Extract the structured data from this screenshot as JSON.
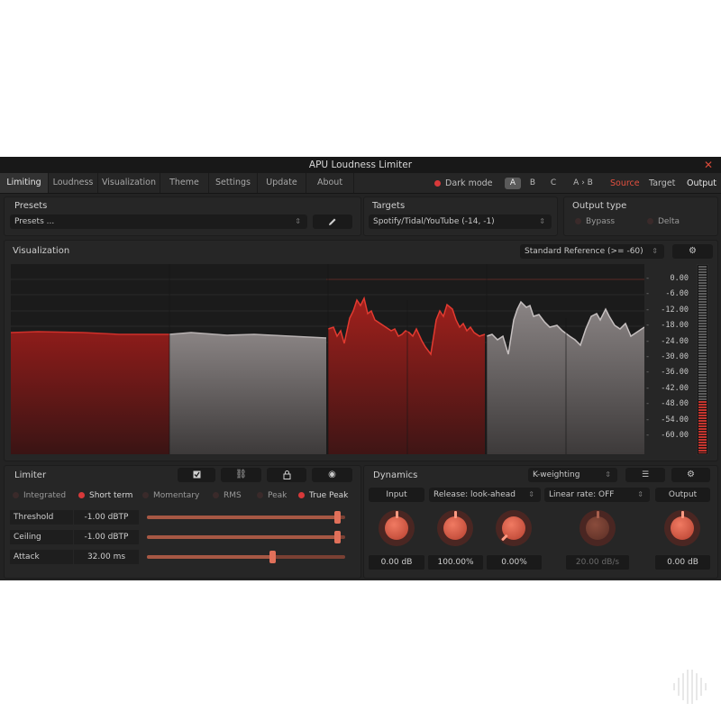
{
  "app": {
    "title": "APU Loudness Limiter"
  },
  "menu": {
    "tabs": [
      "Limiting",
      "Loudness",
      "Visualization",
      "Theme",
      "Settings",
      "Update",
      "About"
    ],
    "active_tab": "Limiting",
    "dark_mode_label": "Dark mode",
    "ab": [
      "A",
      "B",
      "C",
      "A › B"
    ],
    "ab_selected": "A",
    "modes": [
      "Source",
      "Target",
      "Output"
    ],
    "mode_active": "Source"
  },
  "presets": {
    "title": "Presets",
    "value": "Presets ...",
    "edit_icon": "pencil-icon"
  },
  "targets": {
    "title": "Targets",
    "value": "Spotify/Tidal/YouTube (-14, -1)"
  },
  "output_type": {
    "title": "Output type",
    "bypass": "Bypass",
    "delta": "Delta"
  },
  "visualization": {
    "title": "Visualization",
    "reference": "Standard Reference (>= -60)",
    "scale": [
      "0.00",
      "-6.00",
      "-12.00",
      "-18.00",
      "-24.00",
      "-30.00",
      "-36.00",
      "-42.00",
      "-48.00",
      "-54.00",
      "-60.00"
    ],
    "meter_level": 0.28
  },
  "limiter": {
    "title": "Limiter",
    "tool_icons": [
      "checkbox-icon",
      "unlink-icon",
      "lock-icon",
      "eye-icon"
    ],
    "measure": [
      {
        "label": "Integrated",
        "on": false
      },
      {
        "label": "Short term",
        "on": true
      },
      {
        "label": "Momentary",
        "on": false
      },
      {
        "label": "RMS",
        "on": false
      },
      {
        "label": "Peak",
        "on": false
      },
      {
        "label": "True Peak",
        "on": true
      }
    ],
    "params": [
      {
        "label": "Threshold",
        "value": "-1.00 dBTP",
        "level": 0.96
      },
      {
        "label": "Ceiling",
        "value": "-1.00 dBTP",
        "level": 0.96
      },
      {
        "label": "Attack",
        "value": "32.00 ms",
        "level": 0.63
      }
    ]
  },
  "dynamics": {
    "title": "Dynamics",
    "weighting": "K-weighting",
    "input_label": "Input",
    "release": "Release: look-ahead",
    "linear_rate": "Linear rate: OFF",
    "output_label": "Output",
    "values": [
      "0.00 dB",
      "100.00%",
      "0.00%",
      "20.00 dB/s",
      "0.00 dB"
    ],
    "knob_levels": [
      0.5,
      0.5,
      0.0,
      0.5,
      0.5
    ]
  },
  "colors": {
    "accent": "#d8393a",
    "knob": "#e0705a",
    "panel": "#262626",
    "background": "#232323"
  }
}
